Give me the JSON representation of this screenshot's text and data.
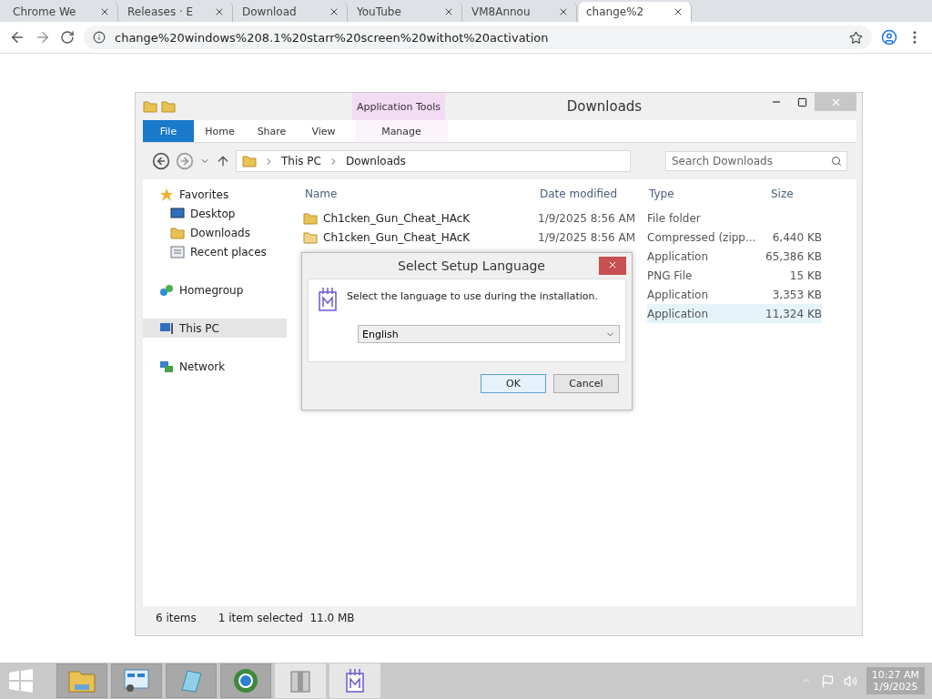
{
  "browser": {
    "tabs": [
      {
        "label": "Chrome We",
        "selected": false
      },
      {
        "label": "Releases · E",
        "selected": false
      },
      {
        "label": "Download",
        "selected": false
      },
      {
        "label": "YouTube",
        "selected": false
      },
      {
        "label": "VM8Annou",
        "selected": false
      },
      {
        "label": "change%2",
        "selected": true
      }
    ],
    "address": "change%20windows%208.1%20starr%20screen%20withot%20activation"
  },
  "explorer": {
    "title": "Downloads",
    "context_tab": "Application Tools",
    "ribbon_tabs": [
      {
        "label": "File",
        "kind": "file"
      },
      {
        "label": "Home",
        "kind": "plain"
      },
      {
        "label": "Share",
        "kind": "plain"
      },
      {
        "label": "View",
        "kind": "plain"
      },
      {
        "label": "Manage",
        "kind": "context"
      }
    ],
    "breadcrumb": [
      "This PC",
      "Downloads"
    ],
    "search": {
      "placeholder": "Search Downloads"
    },
    "sidebar": [
      {
        "label": "Favorites",
        "kind": "header",
        "selected": false,
        "children": [
          {
            "label": "Desktop",
            "kind": "desktop",
            "selected": false
          },
          {
            "label": "Downloads",
            "kind": "downloads",
            "selected": false
          },
          {
            "label": "Recent places",
            "kind": "recent",
            "selected": false
          }
        ]
      },
      {
        "label": "Homegroup",
        "kind": "homegroup",
        "selected": false
      },
      {
        "label": "This PC",
        "kind": "pc",
        "selected": true
      },
      {
        "label": "Network",
        "kind": "network",
        "selected": false
      }
    ],
    "columns": [
      "Name",
      "Date modified",
      "Type",
      "Size"
    ],
    "rows": [
      {
        "name": "Ch1cken_Gun_Cheat_HAcK",
        "date": "1/9/2025 8:56 AM",
        "type": "File folder",
        "size": "",
        "kind": "folder",
        "selected": false
      },
      {
        "name": "Ch1cken_Gun_Cheat_HAcK",
        "date": "1/9/2025 8:56 AM",
        "type": "Compressed (zipp...",
        "size": "6,440 KB",
        "kind": "zip",
        "selected": false
      },
      {
        "type": "Application",
        "size": "65,386 KB",
        "selected": false
      },
      {
        "type": "PNG File",
        "size": "15 KB",
        "selected": false
      },
      {
        "type": "Application",
        "size": "3,353 KB",
        "selected": false
      },
      {
        "type": "Application",
        "size": "11,324 KB",
        "selected": true
      }
    ],
    "status": {
      "count": "6 items",
      "selection": "1 item selected  11.0 MB"
    }
  },
  "dialog": {
    "title": "Select Setup Language",
    "message": "Select the language to use during the installation.",
    "language": "English",
    "buttons": [
      {
        "label": "OK",
        "selected": true
      },
      {
        "label": "Cancel",
        "selected": false
      }
    ]
  },
  "taskbar": {
    "apps": [
      {
        "kind": "explorer",
        "selected": false
      },
      {
        "kind": "control",
        "selected": false
      },
      {
        "kind": "notepad",
        "selected": false
      },
      {
        "kind": "browser",
        "selected": false
      },
      {
        "kind": "archive",
        "selected": true
      },
      {
        "kind": "setup",
        "selected": true
      }
    ],
    "time": "10:27 AM",
    "date": "1/9/2025"
  }
}
